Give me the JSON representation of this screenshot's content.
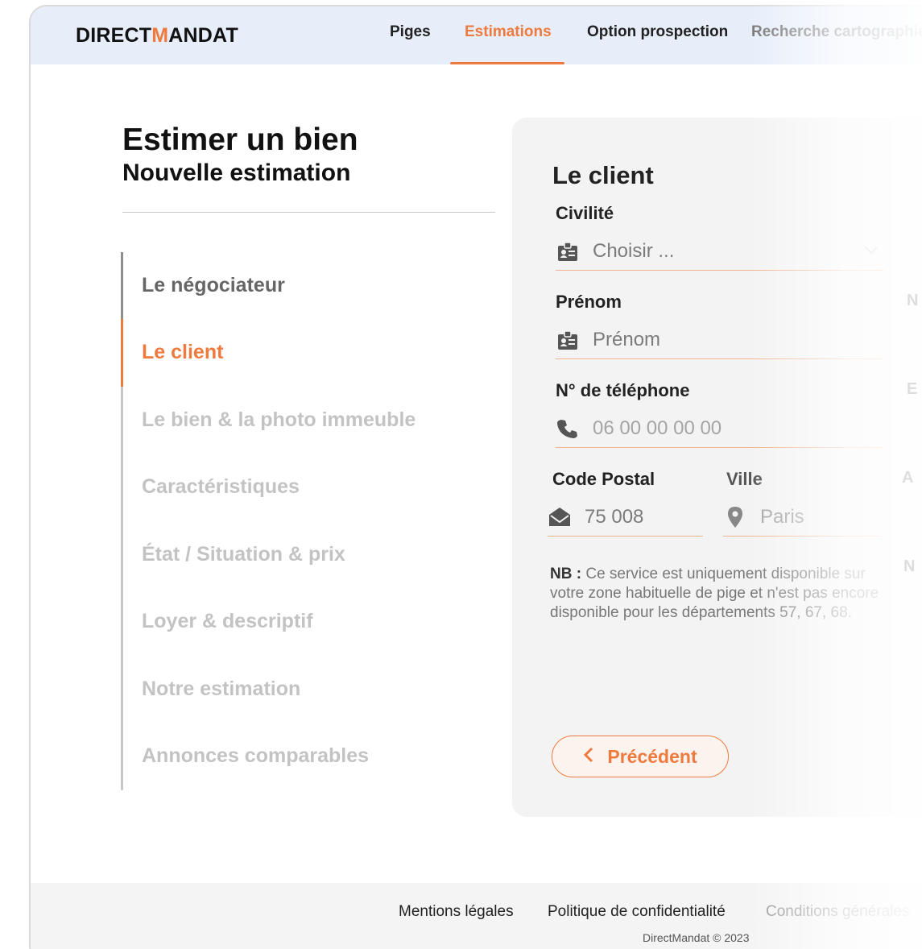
{
  "header": {
    "logo_prefix": "DIRECT",
    "logo_m": "M",
    "logo_suffix": "ANDAT",
    "nav": {
      "piges": "Piges",
      "estimations": "Estimations",
      "option_prospection": "Option prospection",
      "recherche": "Recherche cartographie"
    }
  },
  "page": {
    "title": "Estimer un bien",
    "subtitle": "Nouvelle estimation"
  },
  "steps": [
    "Le négociateur",
    "Le client",
    "Le bien & la photo immeuble",
    "Caractéristiques",
    "État / Situation & prix",
    "Loyer & descriptif",
    "Notre estimation",
    "Annonces comparables"
  ],
  "form": {
    "title": "Le client",
    "civilite_label": "Civilité",
    "civilite_placeholder": "Choisir ...",
    "prenom_label": "Prénom",
    "prenom_placeholder": "Prénom",
    "telephone_label": "N° de téléphone",
    "telephone_placeholder": "06 00 00 00 00",
    "code_postal_label": "Code Postal",
    "code_postal_placeholder": "75 008",
    "ville_label": "Ville",
    "ville_placeholder": "Paris",
    "note_prefix": "NB :",
    "note_text": " Ce service est uniquement disponible sur votre zone habituelle de pige et n'est pas encore disponible pour les départements 57, 67, 68.",
    "prev_button": "Précédent"
  },
  "ghost": {
    "n1": "N",
    "e": "E",
    "a": "A",
    "n2": "N"
  },
  "footer": {
    "mentions": "Mentions légales",
    "politique": "Politique de confidentialité",
    "conditions": "Conditions générales",
    "copyright": "DirectMandat © 2023"
  },
  "colors": {
    "accent": "#ee7a3e",
    "header_bg": "#e7eefa",
    "card_bg": "#f3f3f3"
  }
}
